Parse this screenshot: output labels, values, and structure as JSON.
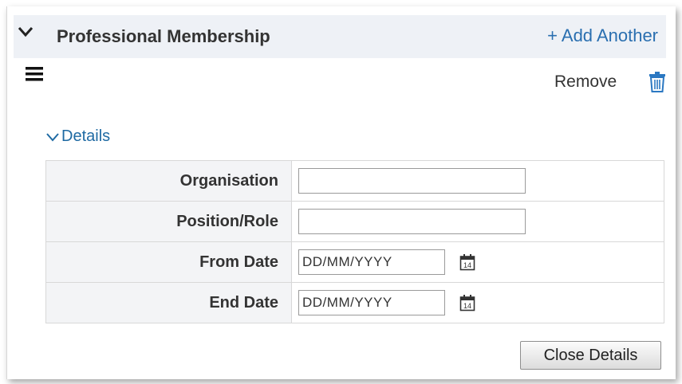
{
  "section": {
    "title": "Professional Membership",
    "add_another_label": "+ Add Another",
    "remove_label": "Remove"
  },
  "details": {
    "toggle_label": "Details",
    "fields": {
      "organisation": {
        "label": "Organisation",
        "value": ""
      },
      "position_role": {
        "label": "Position/Role",
        "value": ""
      },
      "from_date": {
        "label": "From Date",
        "placeholder": "DD/MM/YYYY",
        "value": ""
      },
      "end_date": {
        "label": "End Date",
        "placeholder": "DD/MM/YYYY",
        "value": ""
      }
    },
    "calendar_day": "14",
    "close_label": "Close Details"
  },
  "icons": {
    "collapse": "chevron-down-icon",
    "menu": "hamburger-menu-icon",
    "remove": "trash-icon",
    "calendar": "calendar-icon"
  },
  "colors": {
    "link": "#2a6fb0",
    "header_bg": "#eef1f6",
    "label_bg": "#f3f4f6",
    "trash": "#2b78c2"
  }
}
